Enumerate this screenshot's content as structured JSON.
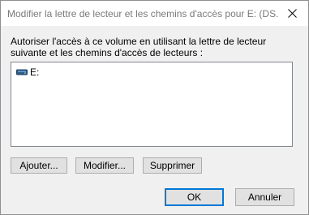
{
  "window": {
    "title": "Modifier la lettre de lecteur et les chemins d'accès pour E: (DS..."
  },
  "description": "Autoriser l'accès à ce volume en utilisant la lettre de lecteur suivante et les chemins d'accès de lecteurs :",
  "list": {
    "items": [
      {
        "label": "E:",
        "icon": "drive-icon"
      }
    ]
  },
  "buttons": {
    "add": "Ajouter...",
    "modify": "Modifier...",
    "remove": "Supprimer",
    "ok": "OK",
    "cancel": "Annuler"
  },
  "colors": {
    "drive_icon": "#2d5c8a",
    "default_button_border": "#0078d7"
  }
}
